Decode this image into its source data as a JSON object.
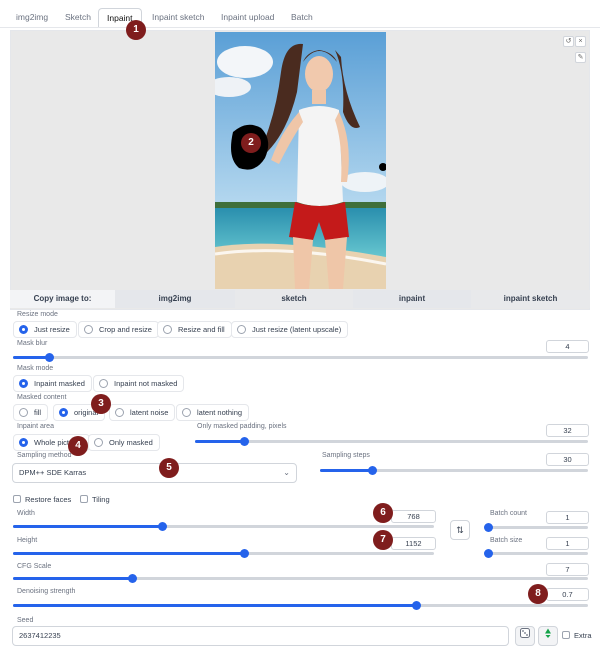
{
  "tabs": [
    "img2img",
    "Sketch",
    "Inpaint",
    "Inpaint sketch",
    "Inpaint upload",
    "Batch"
  ],
  "active_tab": "Inpaint",
  "image_controls": {
    "reset": "↺",
    "close": "×",
    "brush": "✎"
  },
  "copy_bar": {
    "label": "Copy image to:",
    "targets": [
      "img2img",
      "sketch",
      "inpaint",
      "inpaint sketch"
    ]
  },
  "resize_mode": {
    "label": "Resize mode",
    "options": [
      "Just resize",
      "Crop and resize",
      "Resize and fill",
      "Just resize (latent upscale)"
    ],
    "selected": "Just resize"
  },
  "mask_blur": {
    "label": "Mask blur",
    "value": 4,
    "min": 0,
    "max": 64
  },
  "mask_mode": {
    "label": "Mask mode",
    "options": [
      "Inpaint masked",
      "Inpaint not masked"
    ],
    "selected": "Inpaint masked"
  },
  "masked_content": {
    "label": "Masked content",
    "options": [
      "fill",
      "original",
      "latent noise",
      "latent nothing"
    ],
    "selected": "original"
  },
  "inpaint_area": {
    "label": "Inpaint area",
    "options": [
      "Whole picture",
      "Only masked"
    ],
    "selected": "Whole picture"
  },
  "only_masked_padding": {
    "label": "Only masked padding, pixels",
    "value": 32,
    "min": 0,
    "max": 256
  },
  "sampling_method": {
    "label": "Sampling method",
    "value": "DPM++ SDE Karras"
  },
  "sampling_steps": {
    "label": "Sampling steps",
    "value": 30,
    "min": 1,
    "max": 150
  },
  "restore_faces": {
    "label": "Restore faces",
    "checked": false
  },
  "tiling": {
    "label": "Tiling",
    "checked": false
  },
  "width": {
    "label": "Width",
    "value": 768,
    "min": 64,
    "max": 2048
  },
  "height": {
    "label": "Height",
    "value": 1152,
    "min": 64,
    "max": 2048
  },
  "swap_icon": "⇅",
  "batch_count": {
    "label": "Batch count",
    "value": 1,
    "min": 1,
    "max": 100
  },
  "batch_size": {
    "label": "Batch size",
    "value": 1,
    "min": 1,
    "max": 8
  },
  "cfg_scale": {
    "label": "CFG Scale",
    "value": 7,
    "min": 1,
    "max": 30
  },
  "denoising_strength": {
    "label": "Denoising strength",
    "value": 0.7,
    "min": 0,
    "max": 1
  },
  "seed": {
    "label": "Seed",
    "value": "2637412235"
  },
  "extra": {
    "label": "Extra",
    "checked": false
  },
  "annotations": [
    "1",
    "2",
    "3",
    "4",
    "5",
    "6",
    "7",
    "8"
  ],
  "colors": {
    "accent": "#2563eb",
    "badge": "#7f1d1d",
    "recycle": "#16a34a"
  }
}
